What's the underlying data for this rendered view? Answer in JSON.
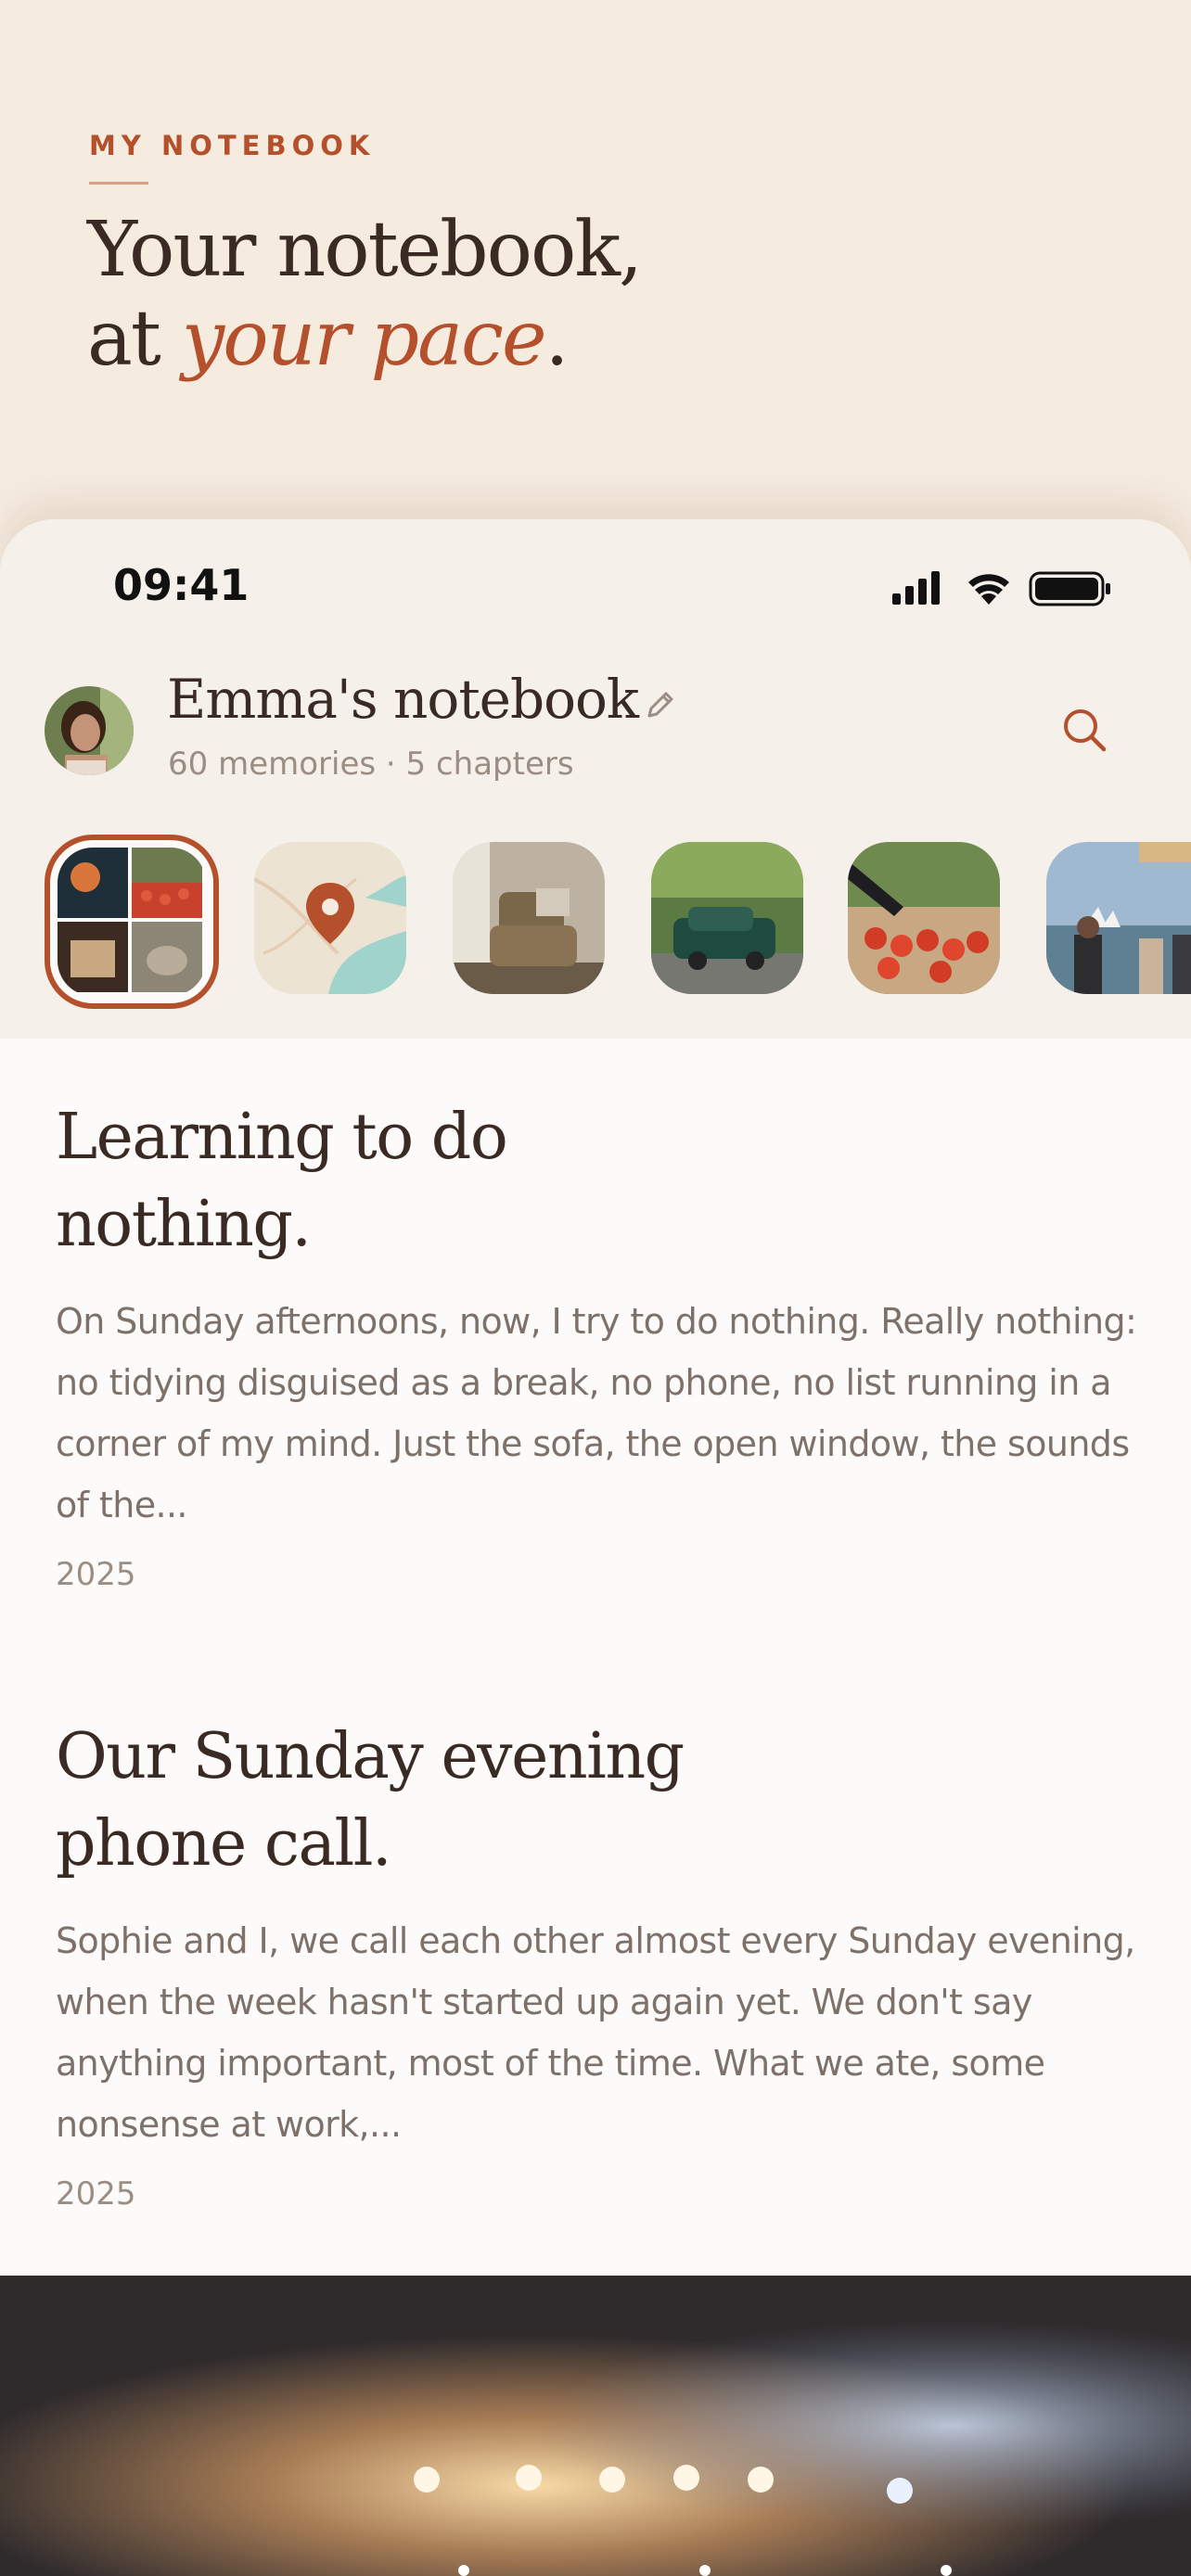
{
  "hero": {
    "eyebrow": "MY NOTEBOOK",
    "title_line1": "Your notebook,",
    "title_at": "at ",
    "title_accent": "your pace",
    "title_period": "."
  },
  "status_bar": {
    "time": "09:41",
    "icons": [
      "signal-icon",
      "wifi-icon",
      "battery-icon"
    ]
  },
  "notebook": {
    "title": "Emma's notebook",
    "meta": "60 memories · 5 chapters"
  },
  "chapters": [
    {
      "name": "collage",
      "selected": true
    },
    {
      "name": "map",
      "selected": false
    },
    {
      "name": "armchair",
      "selected": false
    },
    {
      "name": "green-car",
      "selected": false
    },
    {
      "name": "tomatoes",
      "selected": false
    },
    {
      "name": "harbour",
      "selected": false
    }
  ],
  "entries": [
    {
      "title_line1": "Learning to do",
      "title_line2": "nothing.",
      "excerpt": "On Sunday afternoons, now, I try to do nothing. Really nothing: no tidying disguised as a break, no phone, no list running in a corner of my mind. Just the sofa, the open window, the sounds of the...",
      "year": "2025"
    },
    {
      "title_line1": "Our Sunday evening",
      "title_line2": "phone call.",
      "excerpt": "Sophie and I, we call each other almost every Sunday evening, when the week hasn't started up again yet. We don't say anything important, most of the time. What we ate, some nonsense at work,...",
      "year": "2025"
    }
  ],
  "colors": {
    "accent": "#b5502c",
    "ink": "#3a2a24",
    "muted": "#7d716a",
    "cream": "#f5ebdf"
  }
}
